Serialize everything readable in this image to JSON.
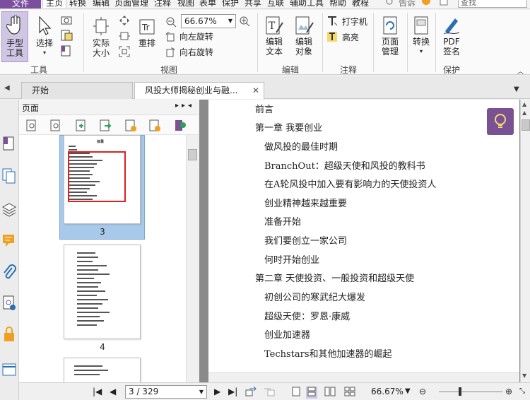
{
  "menubar": {
    "file": "文件",
    "items": [
      "主页",
      "转换",
      "编辑",
      "页面管理",
      "注释",
      "视图",
      "表单",
      "保护",
      "共享",
      "互联",
      "辅助工具",
      "帮助",
      "教程"
    ],
    "active_index": 0,
    "tell_me": "告诉",
    "search_placeholder": "查找"
  },
  "ribbon": {
    "hand_tool": "手型\n工具",
    "select": "选择",
    "actual_size": "实际\n大小",
    "reflow": "重排",
    "zoom_value": "66.67%",
    "rotate_left": "向左旋转",
    "rotate_right": "向右旋转",
    "edit_text": "编辑\n文本",
    "edit_object": "编辑\n对象",
    "typewriter": "打字机",
    "highlight": "高亮",
    "page_manage": "页面\n管理",
    "convert": "转换",
    "pdf_sign": "PDF\n签名",
    "groups": {
      "tools": "工具",
      "view": "视图",
      "edit": "编辑",
      "comment": "注释",
      "protect": "保护"
    }
  },
  "tabs": [
    {
      "label": "开始"
    },
    {
      "label": "风投大师揭秘创业与融..."
    }
  ],
  "page_panel": {
    "title": "页面",
    "page_numbers": [
      "3",
      "4"
    ],
    "thumb_heading": "目录"
  },
  "document": {
    "toc": [
      {
        "text": "前言",
        "level": 0
      },
      {
        "text": "第一章 我要创业",
        "level": 0
      },
      {
        "text": "做风投的最佳时期",
        "level": 1
      },
      {
        "text": "BranchOut：超级天使和风投的教科书",
        "level": 1
      },
      {
        "text": "在A轮风投中加入要有影响力的天使投资人",
        "level": 1
      },
      {
        "text": "创业精神越来越重要",
        "level": 1
      },
      {
        "text": "准备开始",
        "level": 1
      },
      {
        "text": "我们要创立一家公司",
        "level": 1
      },
      {
        "text": "何时开始创业",
        "level": 1
      },
      {
        "text": "第二章 天使投资、一般投资和超级天使",
        "level": 0
      },
      {
        "text": "初创公司的寒武纪大爆发",
        "level": 1
      },
      {
        "text": "超级天使：罗恩·康威",
        "level": 1
      },
      {
        "text": "创业加速器",
        "level": 1
      },
      {
        "text": "Techstars和其他加速器的崛起",
        "level": 1
      }
    ]
  },
  "statusbar": {
    "page_indicator": "3 / 329",
    "zoom": "66.67%"
  },
  "colors": {
    "brand": "#7b4f9e",
    "selection": "#a9c9ea",
    "highlight_box": "#e02020"
  }
}
